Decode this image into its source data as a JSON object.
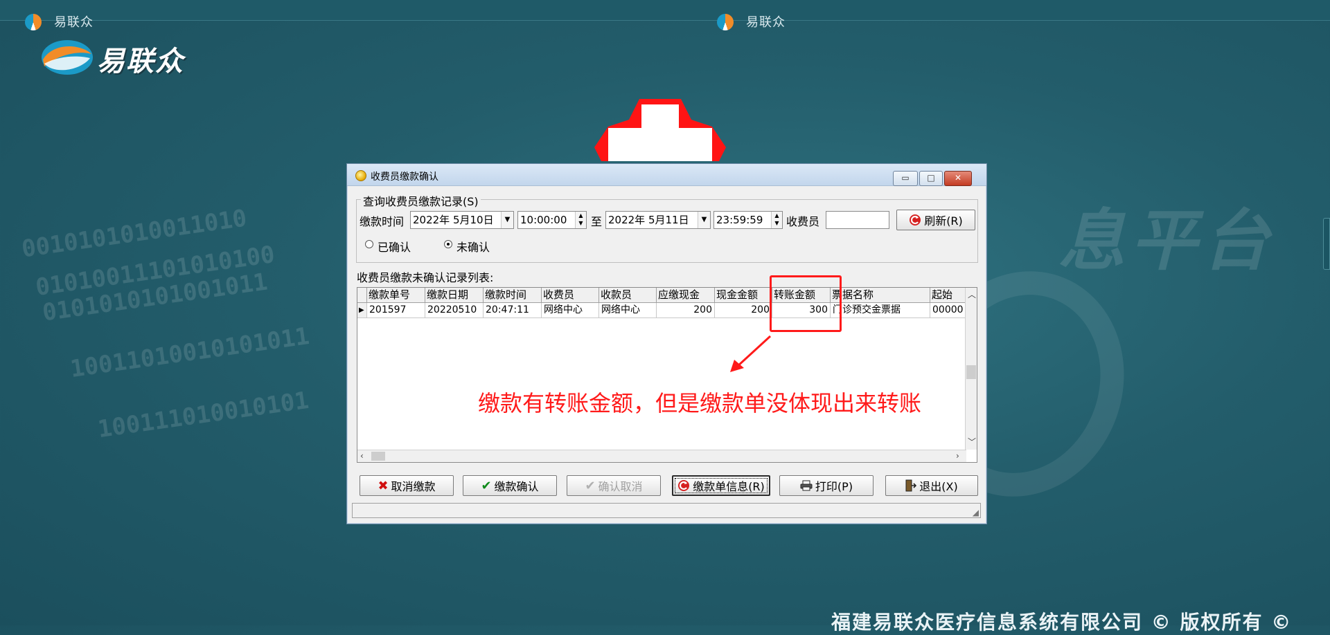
{
  "background": {
    "tiny_titles": [
      "易联众",
      "易联众"
    ],
    "logo_text": "易联众",
    "binary_text": [
      "0010101010011010",
      "01010011101010100",
      "0101010101001011",
      "10011010010101011",
      "100111010010101"
    ],
    "watermark": "息平台",
    "copyright": "福建易联众医疗信息系统有限公司 © 版权所有 ©"
  },
  "dialog": {
    "title": "收费员缴款确认",
    "window_buttons": {
      "minimize": "▭",
      "maximize": "□",
      "close": "✕"
    },
    "query_group": {
      "legend": "查询收费员缴款记录(S)",
      "payment_time_label": "缴款时间",
      "start_date": "2022年 5月10日",
      "start_time": "10:00:00",
      "to_label": "至",
      "end_date": "2022年 5月11日",
      "end_time": "23:59:59",
      "cashier_label": "收费员",
      "cashier_value": "",
      "refresh_label": "刷新(R)",
      "radio_confirmed": "已确认",
      "radio_unconfirmed": "未确认",
      "selected": "未确认"
    },
    "list_label": "收费员缴款未确认记录列表:",
    "grid": {
      "columns": [
        "缴款单号",
        "缴款日期",
        "缴款时间",
        "收费员",
        "收款员",
        "应缴现金",
        "现金金额",
        "转账金额",
        "票据名称",
        "起始"
      ],
      "rows": [
        [
          "201597",
          "20220510",
          "20:47:11",
          "网络中心",
          "网络中心",
          "200",
          "200",
          "300",
          "门诊预交金票据",
          "00000"
        ]
      ]
    },
    "buttons": {
      "cancel_payment": "取消缴款",
      "confirm_payment": "缴款确认",
      "cancel_confirm": "确认取消",
      "payment_info": "缴款单信息(R)",
      "print": "打印(P)",
      "exit": "退出(X)"
    }
  },
  "annotation": {
    "text": "缴款有转账金额，但是缴款单没体现出来转账",
    "color": "#ff1a1a"
  },
  "colors": {
    "desktop": "#235d6b",
    "dialog_face": "#f0f0f0",
    "title_gradient_top": "#dbe8f6",
    "annotation_red": "#ff1a1a"
  }
}
